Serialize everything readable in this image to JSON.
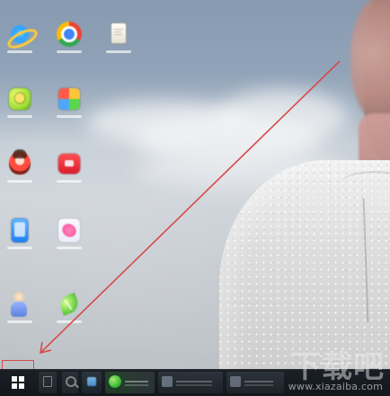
{
  "watermark": {
    "title": "下载吧",
    "domain": "www.xiazaiba.com"
  },
  "taskbar": {
    "start_button": {
      "icon": "windows-icon"
    }
  },
  "desktop_icons": [
    {
      "icon": "ie-icon"
    },
    {
      "icon": "chrome-icon"
    },
    {
      "icon": "doc-icon"
    },
    {
      "icon": "green-icon"
    },
    {
      "icon": "tiles-icon"
    },
    {
      "icon": "avatar-icon"
    },
    {
      "icon": "red-box-icon"
    },
    {
      "icon": "phone-icon"
    },
    {
      "icon": "pink-icon"
    },
    {
      "icon": "person-icon"
    },
    {
      "icon": "leaf-icon"
    }
  ],
  "annotation": {
    "highlight": "start-button-highlight",
    "arrow": "pointer-arrow",
    "accent_color": "#d64a4a"
  }
}
